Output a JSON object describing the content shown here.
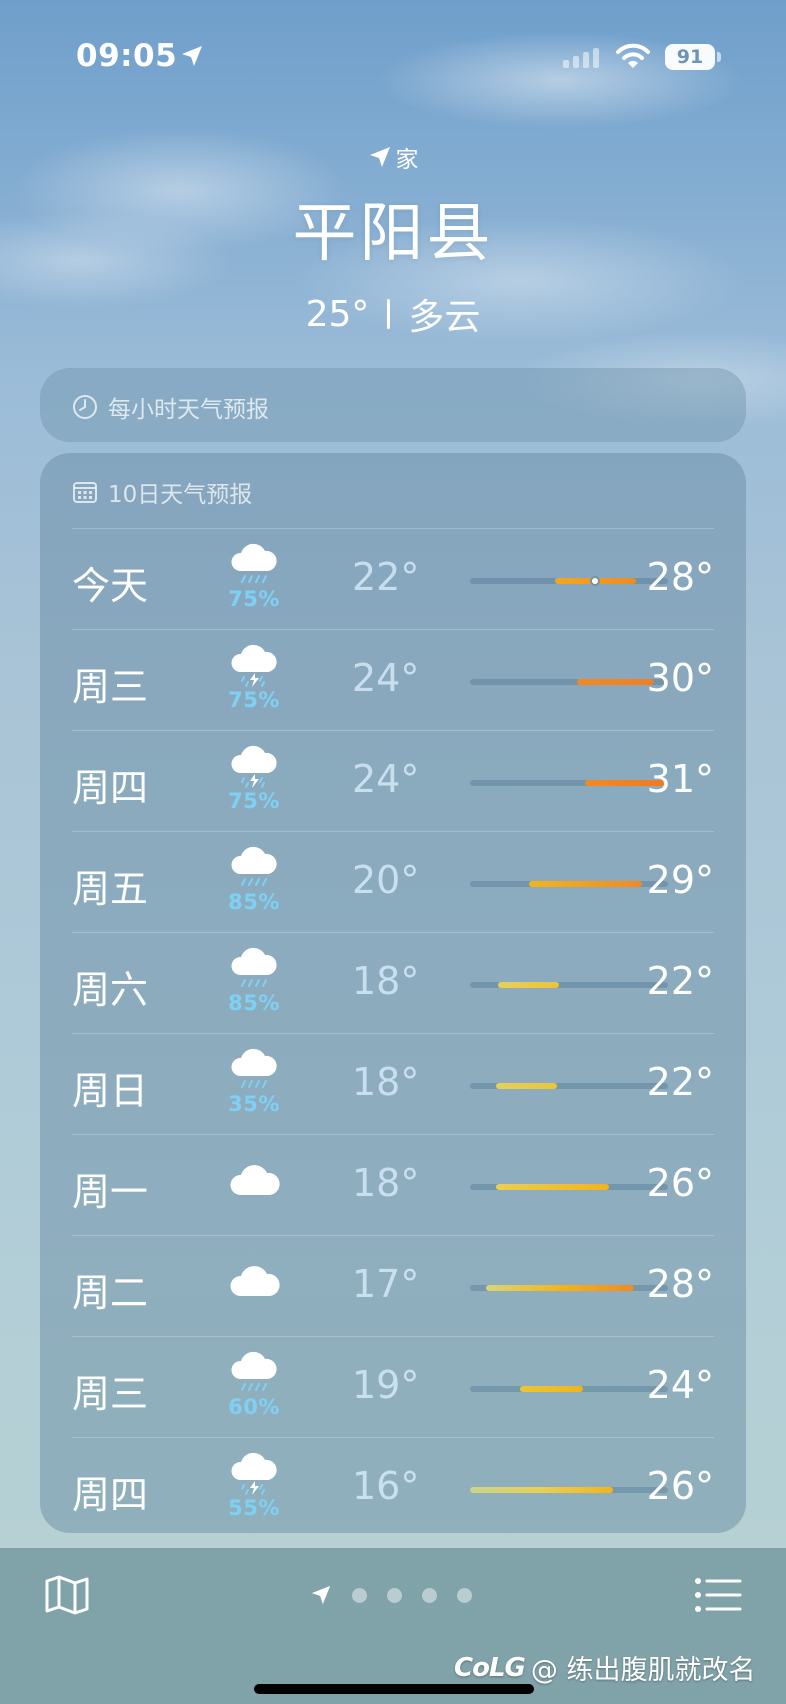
{
  "status": {
    "time": "09:05",
    "battery": "91"
  },
  "header": {
    "location_label": "家",
    "city": "平阳县",
    "temp": "25°",
    "condition": "多云"
  },
  "hourly": {
    "title": "每小时天气预报"
  },
  "daily": {
    "title": "10日天气预报",
    "days": [
      {
        "day": "今天",
        "icon": "cloud-rain-icon",
        "prob": "75%",
        "low": "22°",
        "high": "28°"
      },
      {
        "day": "周三",
        "icon": "cloud-thunderstorm-icon",
        "prob": "75%",
        "low": "24°",
        "high": "30°"
      },
      {
        "day": "周四",
        "icon": "cloud-thunderstorm-icon",
        "prob": "75%",
        "low": "24°",
        "high": "31°"
      },
      {
        "day": "周五",
        "icon": "cloud-rain-icon",
        "prob": "85%",
        "low": "20°",
        "high": "29°"
      },
      {
        "day": "周六",
        "icon": "cloud-rain-icon",
        "prob": "85%",
        "low": "18°",
        "high": "22°"
      },
      {
        "day": "周日",
        "icon": "cloud-rain-icon",
        "prob": "35%",
        "low": "18°",
        "high": "22°"
      },
      {
        "day": "周一",
        "icon": "cloud-icon",
        "prob": "",
        "low": "18°",
        "high": "26°"
      },
      {
        "day": "周二",
        "icon": "cloud-icon",
        "prob": "",
        "low": "17°",
        "high": "28°"
      },
      {
        "day": "周三",
        "icon": "cloud-rain-icon",
        "prob": "60%",
        "low": "19°",
        "high": "24°"
      },
      {
        "day": "周四",
        "icon": "cloud-thunderstorm-icon",
        "prob": "55%",
        "low": "16°",
        "high": "26°"
      }
    ]
  },
  "footer": {
    "watermark_logo": "CoLG",
    "watermark_text": "@ 练出腹肌就改名"
  },
  "colors": {
    "probability": "#7fd0f5",
    "bar_warm": "#f0a020",
    "bar_hot": "#f08a24",
    "bar_mild": "#e8cf55"
  }
}
